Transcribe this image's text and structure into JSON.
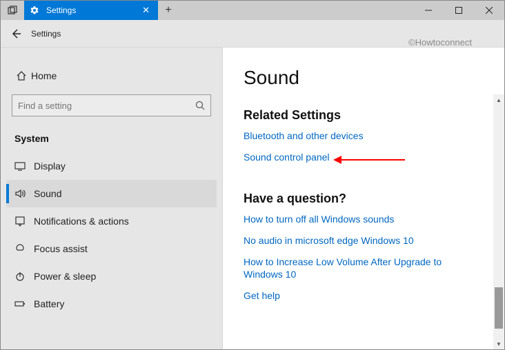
{
  "titlebar": {
    "tab_label": "Settings",
    "new_tab": "+"
  },
  "header": {
    "title": "Settings"
  },
  "watermark": "©Howtoconnect",
  "sidebar": {
    "home_label": "Home",
    "search_placeholder": "Find a setting",
    "category": "System",
    "items": [
      {
        "label": "Display",
        "icon": "display-icon"
      },
      {
        "label": "Sound",
        "icon": "sound-icon"
      },
      {
        "label": "Notifications & actions",
        "icon": "notifications-icon"
      },
      {
        "label": "Focus assist",
        "icon": "focus-assist-icon"
      },
      {
        "label": "Power & sleep",
        "icon": "power-icon"
      },
      {
        "label": "Battery",
        "icon": "battery-icon"
      }
    ],
    "selected_index": 1
  },
  "main": {
    "title": "Sound",
    "related_heading": "Related Settings",
    "related_links": [
      "Bluetooth and other devices",
      "Sound control panel"
    ],
    "question_heading": "Have a question?",
    "question_links": [
      "How to turn off all Windows sounds",
      "No audio in microsoft edge Windows 10",
      "How to Increase Low Volume After Upgrade to Windows 10",
      "Get help"
    ]
  },
  "colors": {
    "accent": "#0078d7",
    "link": "#0067c0",
    "annotation": "#ff0000"
  }
}
